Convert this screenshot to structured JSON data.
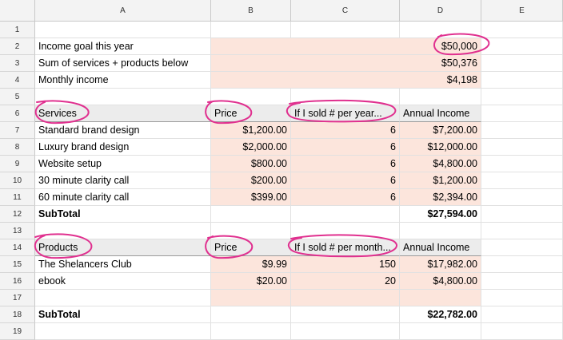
{
  "columns": [
    "A",
    "B",
    "C",
    "D",
    "E"
  ],
  "rows": [
    "1",
    "2",
    "3",
    "4",
    "5",
    "6",
    "7",
    "8",
    "9",
    "10",
    "11",
    "12",
    "13",
    "14",
    "15",
    "16",
    "17",
    "18",
    "19"
  ],
  "cells": {
    "r2": {
      "a": "Income goal this year",
      "d": "$50,000"
    },
    "r3": {
      "a": "Sum of services + products below",
      "d": "$50,376"
    },
    "r4": {
      "a": "Monthly income",
      "d": "$4,198"
    },
    "r6": {
      "a": "Services",
      "b": "Price",
      "c": "If I sold # per year...",
      "d": "Annual Income"
    },
    "r7": {
      "a": "Standard brand design",
      "b": "$1,200.00",
      "c": "6",
      "d": "$7,200.00"
    },
    "r8": {
      "a": "Luxury brand design",
      "b": "$2,000.00",
      "c": "6",
      "d": "$12,000.00"
    },
    "r9": {
      "a": "Website setup",
      "b": "$800.00",
      "c": "6",
      "d": "$4,800.00"
    },
    "r10": {
      "a": "30 minute clarity call",
      "b": "$200.00",
      "c": "6",
      "d": "$1,200.00"
    },
    "r11": {
      "a": "60 minute clarity call",
      "b": "$399.00",
      "c": "6",
      "d": "$2,394.00"
    },
    "r12": {
      "a": "SubTotal",
      "d": "$27,594.00"
    },
    "r14": {
      "a": "Products",
      "b": "Price",
      "c": "If I sold # per month...",
      "d": "Annual Income"
    },
    "r15": {
      "a": "The Shelancers Club",
      "b": "$9.99",
      "c": "150",
      "d": "$17,982.00"
    },
    "r16": {
      "a": "ebook",
      "b": "$20.00",
      "c": "20",
      "d": "$4,800.00"
    },
    "r18": {
      "a": "SubTotal",
      "d": "$22,782.00"
    }
  },
  "colors": {
    "pink_fill": "#fce5dc",
    "header_gray": "#ececec",
    "annotation": "#e0308f"
  }
}
